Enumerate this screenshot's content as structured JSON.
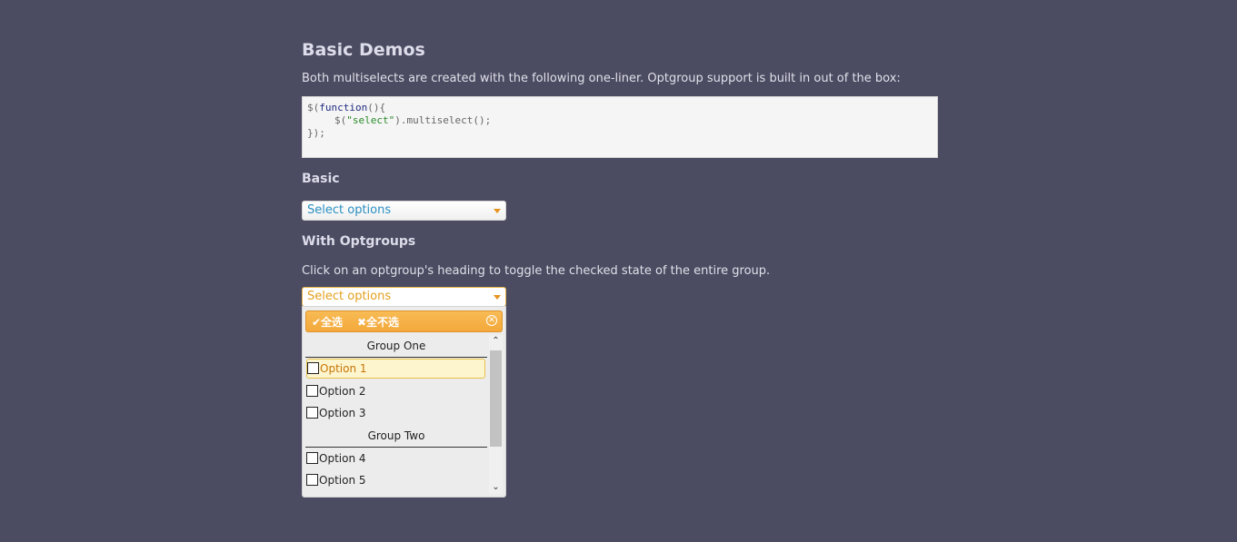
{
  "section_title": "Basic Demos",
  "intro_text": "Both multiselects are created with the following one-liner. Optgroup support is built in out of the box:",
  "code": {
    "line1_a": "$(",
    "line1_kw": "function",
    "line1_b": "(){",
    "line2_a": "$(",
    "line2_str": "\"select\"",
    "line2_b": ").multiselect();",
    "line3": "});"
  },
  "basic": {
    "heading": "Basic",
    "button_text": "Select options"
  },
  "optgroups": {
    "heading": "With Optgroups",
    "note": "Click on an optgroup's heading to toggle the checked state of the entire group.",
    "button_text": "Select options",
    "menu": {
      "check_all": "✔全选",
      "uncheck_all": "✖全不选",
      "close": "✕",
      "groups": [
        {
          "label": "Group One",
          "options": [
            {
              "label": "Option 1"
            },
            {
              "label": "Option 2"
            },
            {
              "label": "Option 3"
            }
          ]
        },
        {
          "label": "Group Two",
          "options": [
            {
              "label": "Option 4"
            },
            {
              "label": "Option 5"
            }
          ]
        }
      ]
    }
  },
  "colors": {
    "background": "#4b4b61",
    "accent_orange": "#f3a83a",
    "basic_text": "#2a8fc0"
  }
}
